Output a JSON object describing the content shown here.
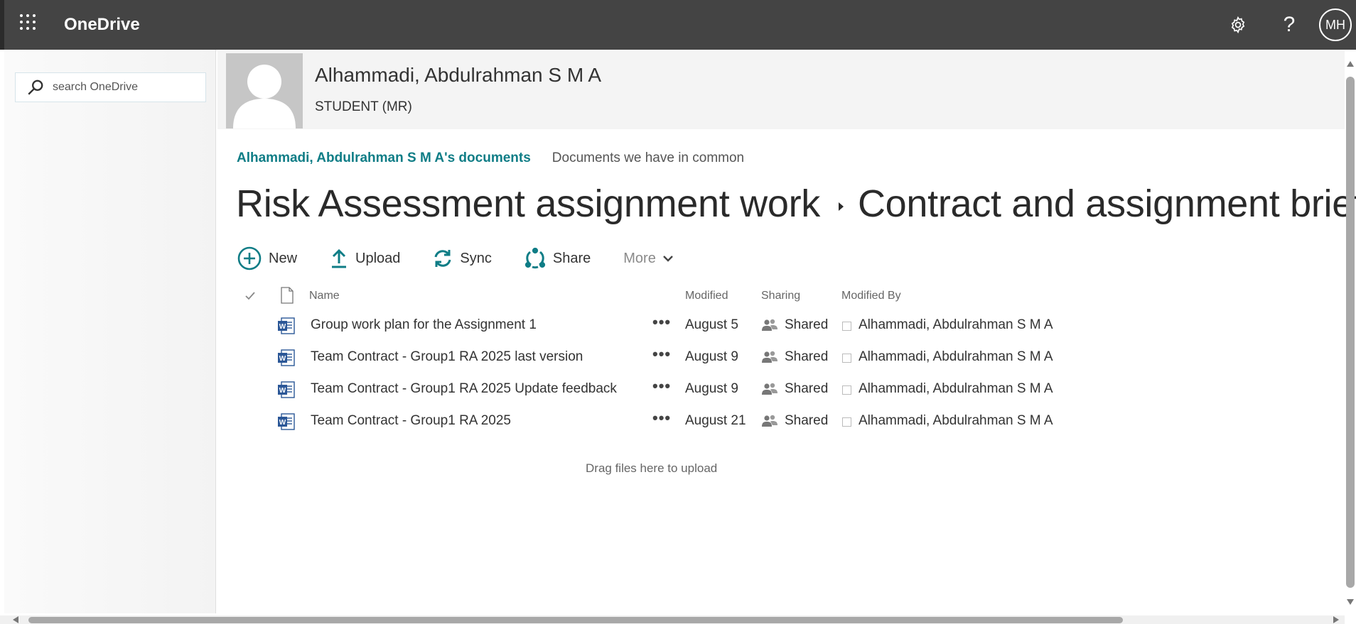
{
  "suitebar": {
    "app_name": "OneDrive",
    "waffle_icon": "waffle-icon",
    "settings_icon": "gear-icon",
    "help_label": "?",
    "avatar_initials": "MH"
  },
  "search": {
    "placeholder": "search OneDrive",
    "value": ""
  },
  "profile": {
    "name": "Alhammadi, Abdulrahman S M A",
    "title": "STUDENT (MR)"
  },
  "tabs": {
    "active": "Alhammadi, Abdulrahman S M A's documents",
    "other": "Documents we have in common"
  },
  "breadcrumb": {
    "parent": "Risk Assessment assignment work",
    "current": "Contract and assignment brief"
  },
  "commands": {
    "new": "New",
    "upload": "Upload",
    "sync": "Sync",
    "share": "Share",
    "more": "More"
  },
  "columns": {
    "name": "Name",
    "modified": "Modified",
    "sharing": "Sharing",
    "modified_by": "Modified By"
  },
  "files": [
    {
      "name": "Group work plan for the Assignment 1",
      "dots": "•••",
      "modified": "August 5",
      "sharing": "Shared",
      "modified_by": "Alhammadi, Abdulrahman S M A"
    },
    {
      "name": "Team Contract - Group1 RA 2025 last version",
      "dots": "•••",
      "modified": "August 9",
      "sharing": "Shared",
      "modified_by": "Alhammadi, Abdulrahman S M A"
    },
    {
      "name": "Team Contract - Group1 RA 2025 Update feedback",
      "dots": "•••",
      "modified": "August 9",
      "sharing": "Shared",
      "modified_by": "Alhammadi, Abdulrahman S M A"
    },
    {
      "name": "Team Contract - Group1 RA 2025",
      "dots": "•••",
      "modified": "August 21",
      "sharing": "Shared",
      "modified_by": "Alhammadi, Abdulrahman S M A"
    }
  ],
  "drop_hint": "Drag files here to upload",
  "colors": {
    "suitebar": "#444444",
    "accent": "#0f7d86"
  }
}
